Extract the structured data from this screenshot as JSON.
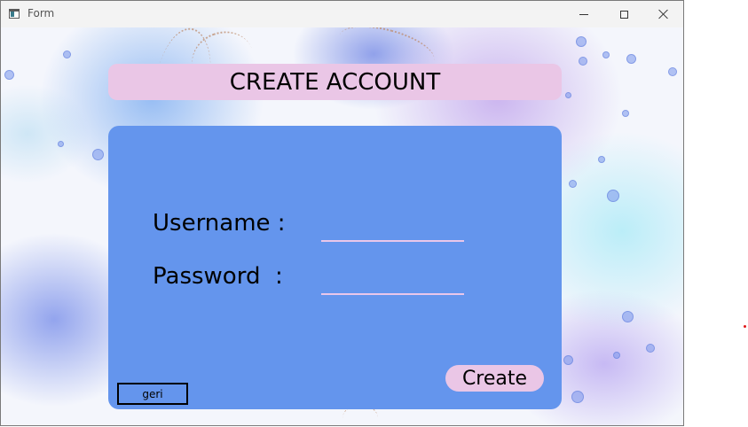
{
  "window": {
    "title": "Form",
    "controls": [
      "minimize-icon",
      "maximize-icon",
      "close-icon"
    ]
  },
  "header": {
    "title": "CREATE ACCOUNT"
  },
  "form": {
    "username_label": "Username :",
    "username_value": "",
    "password_label": "Password  :",
    "password_value": "",
    "create_label": "Create",
    "back_label": "geri"
  },
  "colors": {
    "panel": "#6495ed",
    "banner": "#eac6e6",
    "button": "#eac6e6",
    "input_underline": "#e9c7ea"
  }
}
